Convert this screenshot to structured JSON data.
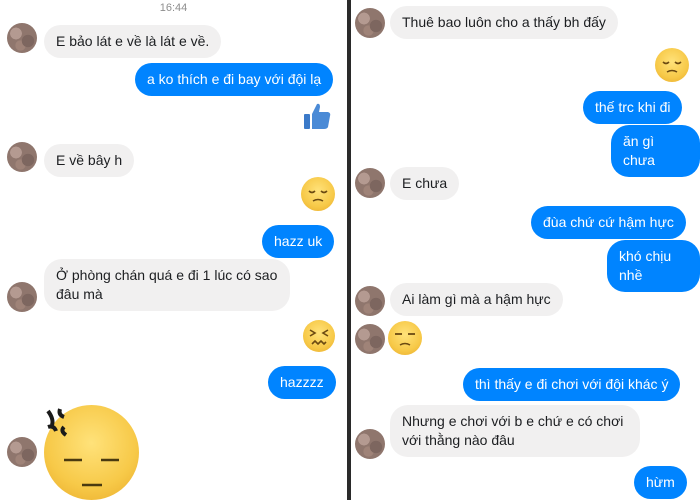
{
  "left": {
    "time": "16:44",
    "messages": {
      "m1": "E bảo lát e về là lát e về.",
      "m2": "a ko thích e đi bay với đội lạ",
      "m3": "E về bây h",
      "m4": "hazz uk",
      "m5": "Ở phòng chán quá e đi 1 lúc có sao đâu mà",
      "m6": "hazzzz"
    }
  },
  "right": {
    "messages": {
      "m1": "Thuê bao luôn cho a thấy bh đấy",
      "m2": "thế trc khi đi",
      "m3": "ăn gì chưa",
      "m4": "E chưa",
      "m5": "đùa chứ cứ hậm hực",
      "m6": "khó chịu nhề",
      "m7": "Ai làm gì mà a hậm hực",
      "m8": "thì thấy e đi chơi với đội khác ý",
      "m9": "Nhưng e chơi với b e chứ e có chơi với thằng nào đâu",
      "m10": "hừm"
    }
  },
  "colors": {
    "outgoing": "#0084ff",
    "incoming": "#f1f0f0"
  },
  "icons": [
    "thumbs-up-icon",
    "pensive-emoji-icon",
    "confounded-emoji-icon",
    "unamused-emoji-icon",
    "angry-sticker-icon"
  ]
}
